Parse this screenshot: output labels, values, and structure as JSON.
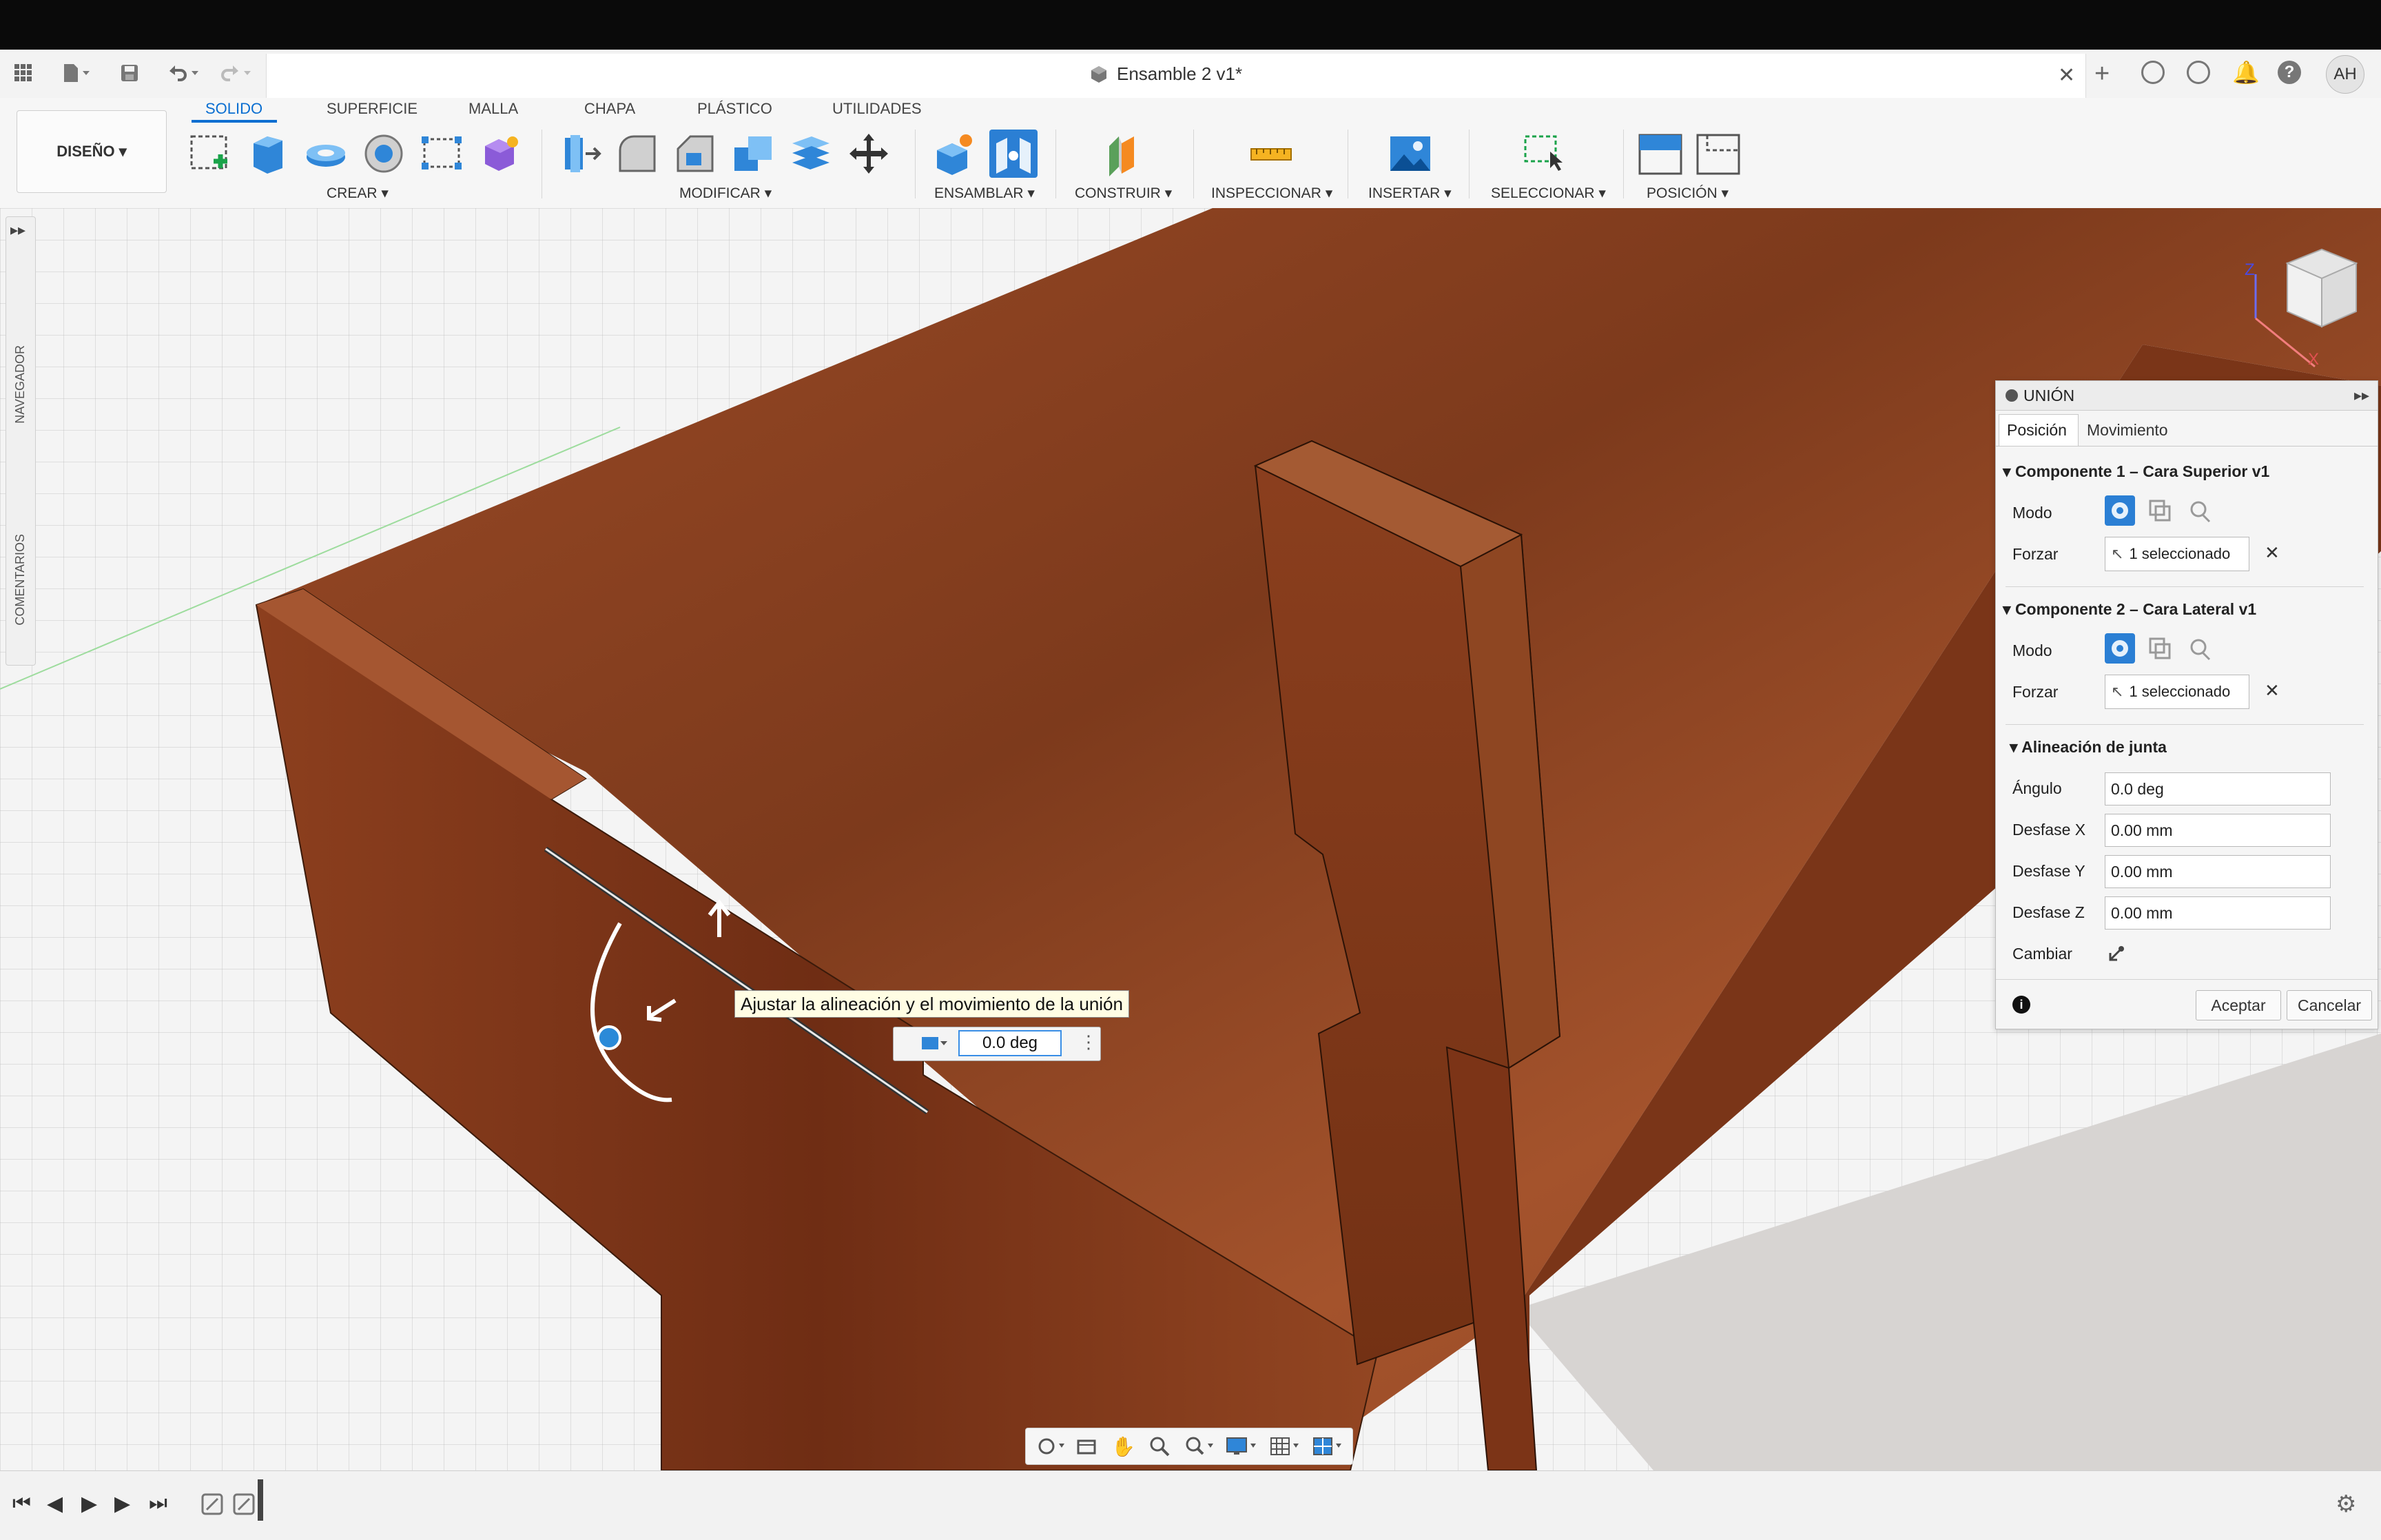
{
  "app": {
    "document_title": "Ensamble 2 v1*",
    "user_initials": "AH"
  },
  "toolbar_icons": [
    "grid-menu-icon",
    "file-icon",
    "save-icon",
    "undo-icon",
    "redo-icon",
    "close-tab-icon",
    "new-tab-icon",
    "extensions-icon",
    "job-status-icon",
    "notifications-icon",
    "help-icon"
  ],
  "workspace": {
    "label": "DISEÑO ▾"
  },
  "ribbon": {
    "tabs": [
      "SOLIDO",
      "SUPERFICIE",
      "MALLA",
      "CHAPA",
      "PLÁSTICO",
      "UTILIDADES"
    ],
    "active_tab": "SOLIDO",
    "groups": {
      "crear": "CREAR ▾",
      "modificar": "MODIFICAR ▾",
      "ensamblar": "ENSAMBLAR ▾",
      "construir": "CONSTRUIR ▾",
      "inspeccionar": "INSPECCIONAR ▾",
      "insertar": "INSERTAR ▾",
      "seleccionar": "SELECCIONAR ▾",
      "posicion": "POSICIÓN ▾"
    }
  },
  "side": {
    "navigator": "NAVEGADOR",
    "comments": "COMENTARIOS"
  },
  "viewcube": {
    "z": "Z",
    "x": "X"
  },
  "joint_panel": {
    "title": "UNIÓN",
    "tabs": [
      "Posición",
      "Movimiento"
    ],
    "component1": {
      "header": "Componente 1 – Cara Superior v1",
      "mode_label": "Modo",
      "force_label": "Forzar",
      "selection": "1 seleccionado"
    },
    "component2": {
      "header": "Componente 2 – Cara Lateral v1",
      "mode_label": "Modo",
      "force_label": "Forzar",
      "selection": "1 seleccionado"
    },
    "alignment": {
      "header": "Alineación de junta",
      "angle_label": "Ángulo",
      "angle_value": "0.0 deg",
      "offset_x_label": "Desfase X",
      "offset_x_value": "0.00 mm",
      "offset_y_label": "Desfase Y",
      "offset_y_value": "0.00 mm",
      "offset_z_label": "Desfase Z",
      "offset_z_value": "0.00 mm",
      "flip_label": "Cambiar"
    },
    "buttons": {
      "ok": "Aceptar",
      "cancel": "Cancelar"
    }
  },
  "canvas_overlay": {
    "tooltip": "Ajustar la alineación y el movimiento de la unión",
    "angle_value": "0.0 deg"
  },
  "colors": {
    "accent": "#0a6ed1",
    "wood_dark": "#6e2f16",
    "wood_mid": "#9a4a26",
    "wood_light": "#b8683e"
  }
}
